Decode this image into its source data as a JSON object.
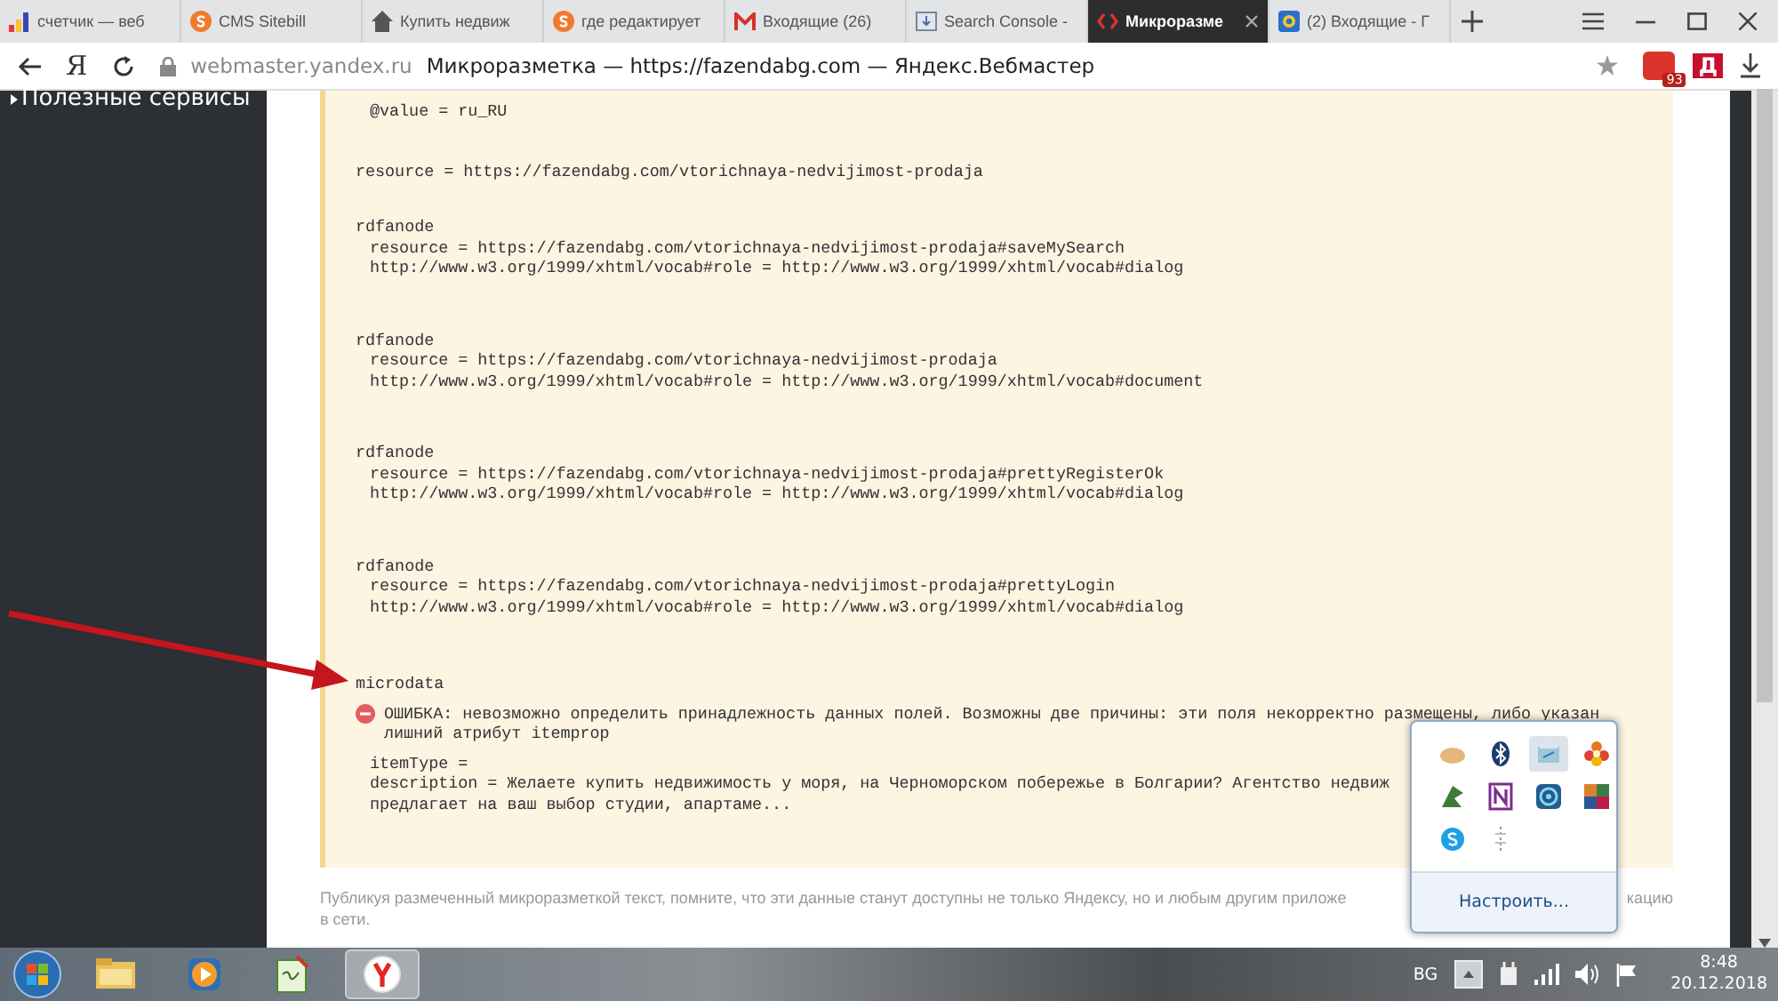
{
  "tabs": [
    {
      "title": "счетчик — веб",
      "selected": false
    },
    {
      "title": "CMS Sitebill",
      "selected": false
    },
    {
      "title": "Купить недвиж",
      "selected": false
    },
    {
      "title": "где редактирует",
      "selected": false
    },
    {
      "title": "Входящие (26)",
      "selected": false
    },
    {
      "title": "Search Console -",
      "selected": false
    },
    {
      "title": "Микроразме",
      "selected": true
    },
    {
      "title": "(2) Входящие - Г",
      "selected": false
    }
  ],
  "address_bar": {
    "logo": "Я",
    "domain": "webmaster.yandex.ru",
    "page_title": "Микроразметка — https://fazendabg.com — Яндекс.Вебмастер",
    "extension_badge": "93",
    "extension_letter": "Д"
  },
  "sidebar": {
    "items": [
      {
        "label": "Полезные сервисы"
      }
    ]
  },
  "code": {
    "items": [
      {
        "kind": "attribute",
        "text": "@value = ru_RU"
      },
      {
        "kind": "property",
        "text": "resource = https://fazendabg.com/vtorichnaya-nedvijimost-prodaja"
      },
      {
        "kind": "node",
        "label": "rdfanode",
        "children": [
          {
            "text": "resource = https://fazendabg.com/vtorichnaya-nedvijimost-prodaja#saveMySearch"
          },
          {
            "text": "http://www.w3.org/1999/xhtml/vocab#role = http://www.w3.org/1999/xhtml/vocab#dialog"
          }
        ]
      },
      {
        "kind": "node",
        "label": "rdfanode",
        "children": [
          {
            "text": "resource = https://fazendabg.com/vtorichnaya-nedvijimost-prodaja"
          },
          {
            "text": "http://www.w3.org/1999/xhtml/vocab#role = http://www.w3.org/1999/xhtml/vocab#document"
          }
        ]
      },
      {
        "kind": "node",
        "label": "rdfanode",
        "children": [
          {
            "text": "resource = https://fazendabg.com/vtorichnaya-nedvijimost-prodaja#prettyRegisterOk"
          },
          {
            "text": "http://www.w3.org/1999/xhtml/vocab#role = http://www.w3.org/1999/xhtml/vocab#dialog"
          }
        ]
      },
      {
        "kind": "node",
        "label": "rdfanode",
        "children": [
          {
            "text": "resource = https://fazendabg.com/vtorichnaya-nedvijimost-prodaja#prettyLogin"
          },
          {
            "text": "http://www.w3.org/1999/xhtml/vocab#role = http://www.w3.org/1999/xhtml/vocab#dialog"
          }
        ]
      },
      {
        "kind": "node",
        "label": "microdata",
        "error": "ОШИБКА: невозможно определить принадлежность данных полей. Возможны две причины: эти поля некорректно размещены, либо указан лишний атрибут itemprop",
        "children": [
          {
            "text": "itemType ="
          },
          {
            "text": "description = Желаете купить недвижимость у моря, на Черноморском побережье в Болгарии? Агентство недвиж"
          },
          {
            "text": "предлагает на ваш выбор студии, апартаме..."
          }
        ]
      }
    ]
  },
  "footer_note": {
    "line_start": "Публикуя размеченный микроразметкой текст, помните, что эти данные станут доступны не только Яндексу, но и любым другим приложе",
    "line_end": "кацию",
    "line_2": "в сети."
  },
  "tray_popup": {
    "icons": [
      {
        "selected": false
      },
      {
        "selected": false
      },
      {
        "selected": true
      },
      {
        "selected": false
      },
      {
        "selected": false
      },
      {
        "selected": false
      },
      {
        "selected": false
      },
      {
        "selected": false
      },
      {
        "selected": false
      },
      {
        "selected": false
      }
    ],
    "customize": "Настроить..."
  },
  "taskbar": {
    "apps": [
      {
        "selected": false
      },
      {
        "selected": false
      },
      {
        "selected": false
      },
      {
        "selected": true
      }
    ],
    "language": "BG",
    "time": "8:48",
    "date": "20.12.2018"
  }
}
